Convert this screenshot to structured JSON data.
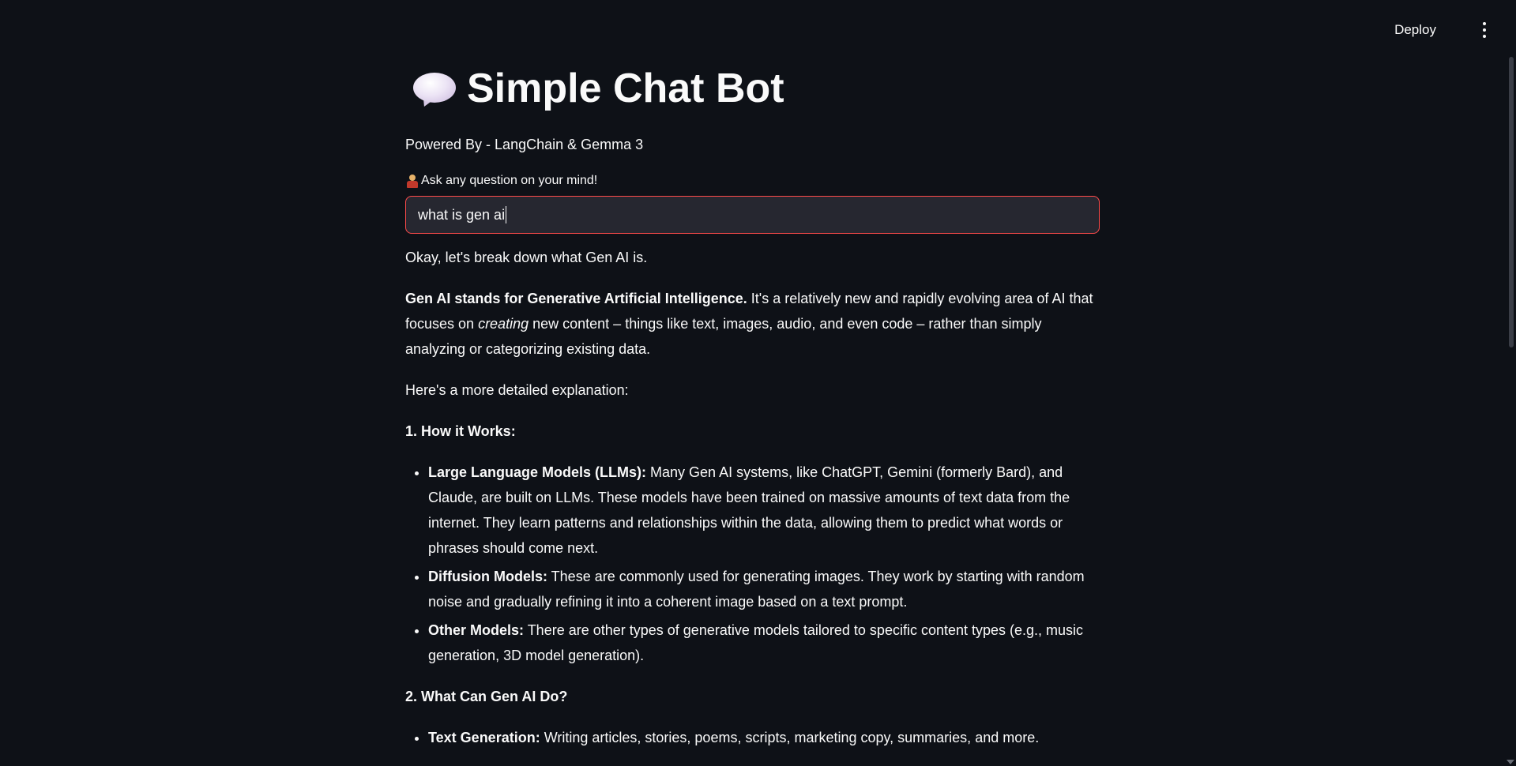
{
  "header": {
    "deploy_label": "Deploy",
    "menu_icon": "kebab-menu-icon"
  },
  "page": {
    "title": "Simple Chat Bot",
    "title_icon": "speech-bubble-icon",
    "subtitle": "Powered By - LangChain & Gemma 3"
  },
  "question": {
    "icon": "person-icon",
    "label": "Ask any question on your mind!",
    "value": "what is gen ai",
    "border_color": "#ff4b4b"
  },
  "answer": {
    "intro": "Okay, let's break down what Gen AI is.",
    "definition_bold": "Gen AI stands for Generative Artificial Intelligence.",
    "definition_pre": " It's a relatively new and rapidly evolving area of AI that focuses on ",
    "definition_em": "creating",
    "definition_post": " new content – things like text, images, audio, and even code – rather than simply analyzing or categorizing existing data.",
    "more": "Here's a more detailed explanation:",
    "section1_heading": "1. How it Works:",
    "section1_items": [
      {
        "term": "Large Language Models (LLMs):",
        "text": " Many Gen AI systems, like ChatGPT, Gemini (formerly Bard), and Claude, are built on LLMs. These models have been trained on massive amounts of text data from the internet. They learn patterns and relationships within the data, allowing them to predict what words or phrases should come next."
      },
      {
        "term": "Diffusion Models:",
        "text": " These are commonly used for generating images. They work by starting with random noise and gradually refining it into a coherent image based on a text prompt."
      },
      {
        "term": "Other Models:",
        "text": " There are other types of generative models tailored to specific content types (e.g., music generation, 3D model generation)."
      }
    ],
    "section2_heading": "2. What Can Gen AI Do?",
    "section2_items": [
      {
        "term": "Text Generation:",
        "text": " Writing articles, stories, poems, scripts, marketing copy, summaries, and more."
      }
    ]
  },
  "colors": {
    "background": "#0e1117",
    "text": "#fafafa",
    "input_bg": "#262730",
    "accent": "#ff4b4b"
  }
}
